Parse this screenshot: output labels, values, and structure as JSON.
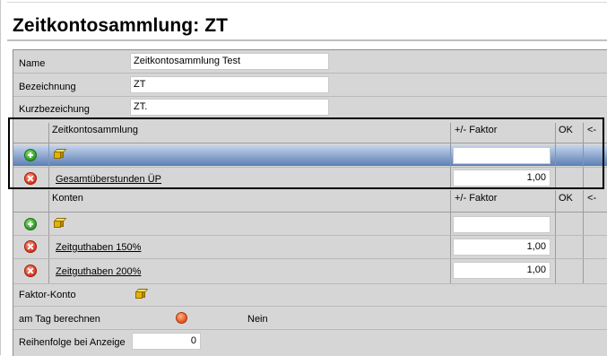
{
  "title": "Zeitkontosammlung: ZT",
  "form": {
    "name_label": "Name",
    "name_value": "Zeitkontosammlung Test",
    "bezeichnung_label": "Bezeichnung",
    "bezeichnung_value": "ZT",
    "kurz_label": "Kurzbezeichung",
    "kurz_value": "ZT."
  },
  "zks_table": {
    "col_name": "Zeitkontosammlung",
    "col_faktor": "+/- Faktor",
    "col_ok": "OK",
    "col_back": "<-",
    "rows": [
      {
        "label": "Gesamtüberstunden ÜP",
        "faktor": "1,00"
      }
    ]
  },
  "konten_table": {
    "col_name": "Konten",
    "col_faktor": "+/- Faktor",
    "col_ok": "OK",
    "col_back": "<-",
    "rows": [
      {
        "label": "Zeitguthaben 150%",
        "faktor": "1,00"
      },
      {
        "label": "Zeitguthaben 200%",
        "faktor": "1,00"
      }
    ]
  },
  "faktor_konto_label": "Faktor-Konto",
  "am_tag_label": "am Tag berechnen",
  "am_tag_value": "Nein",
  "reihenfolge_label": "Reihenfolge bei Anzeige",
  "reihenfolge_value": "0",
  "colors": {
    "selection": "#8fa9cf",
    "panel": "#d6d6d6",
    "add": "#2d9a20",
    "delete": "#d8331c"
  },
  "icons": [
    "plus-circle-icon",
    "cube-icon",
    "delete-circle-icon",
    "radio-off-icon"
  ]
}
